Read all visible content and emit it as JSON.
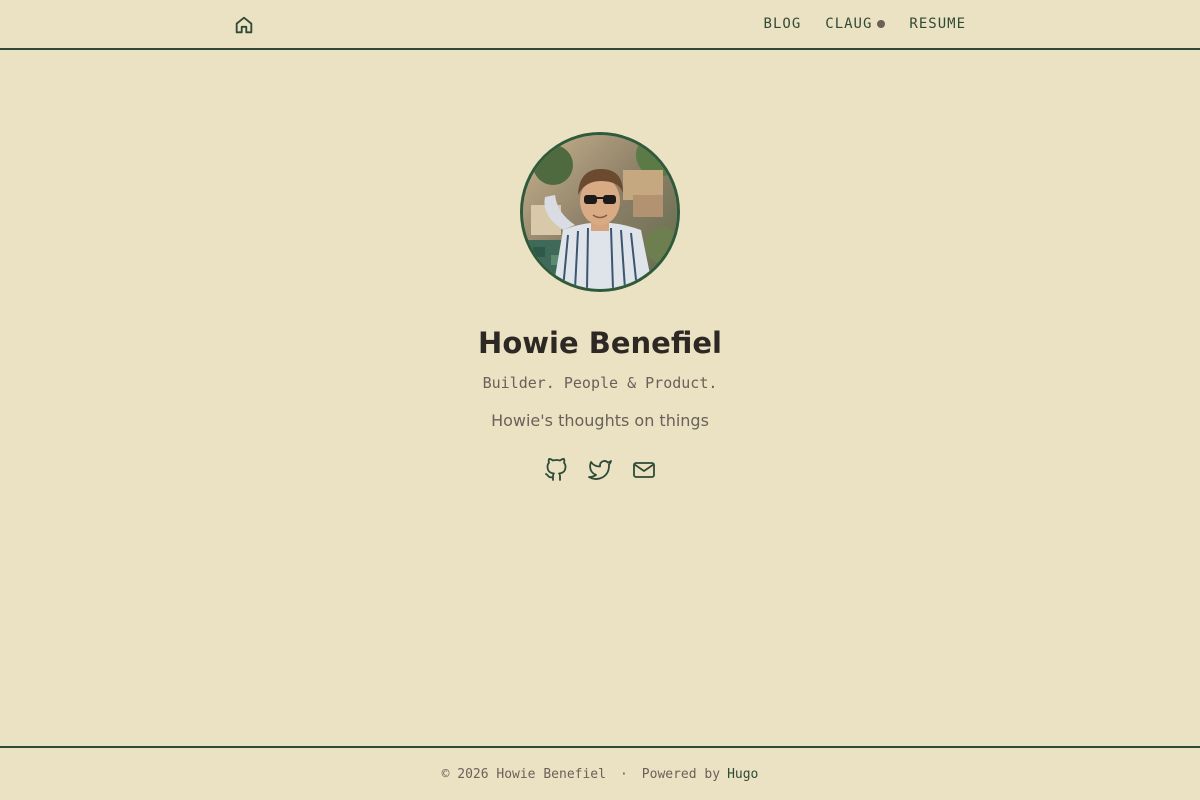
{
  "header": {
    "home_icon": "home-icon",
    "nav": [
      {
        "label": "BLOG"
      },
      {
        "label": "CLAUG",
        "indicator": "status-dot"
      },
      {
        "label": "RESUME"
      }
    ]
  },
  "profile": {
    "avatar": "profile-photo",
    "name": "Howie Benefiel",
    "tagline": "Builder. People & Product.",
    "description": "Howie's thoughts on things",
    "socials": [
      {
        "icon": "github-icon"
      },
      {
        "icon": "twitter-icon"
      },
      {
        "icon": "mail-icon"
      }
    ]
  },
  "footer": {
    "copyright": "© 2026 Howie Benefiel",
    "separator": "·",
    "powered_by": "Powered by",
    "powered_link": "Hugo"
  },
  "colors": {
    "background": "#ebe2c3",
    "accent": "#2f4a36",
    "text": "#2e2824",
    "muted": "#6a6159"
  }
}
